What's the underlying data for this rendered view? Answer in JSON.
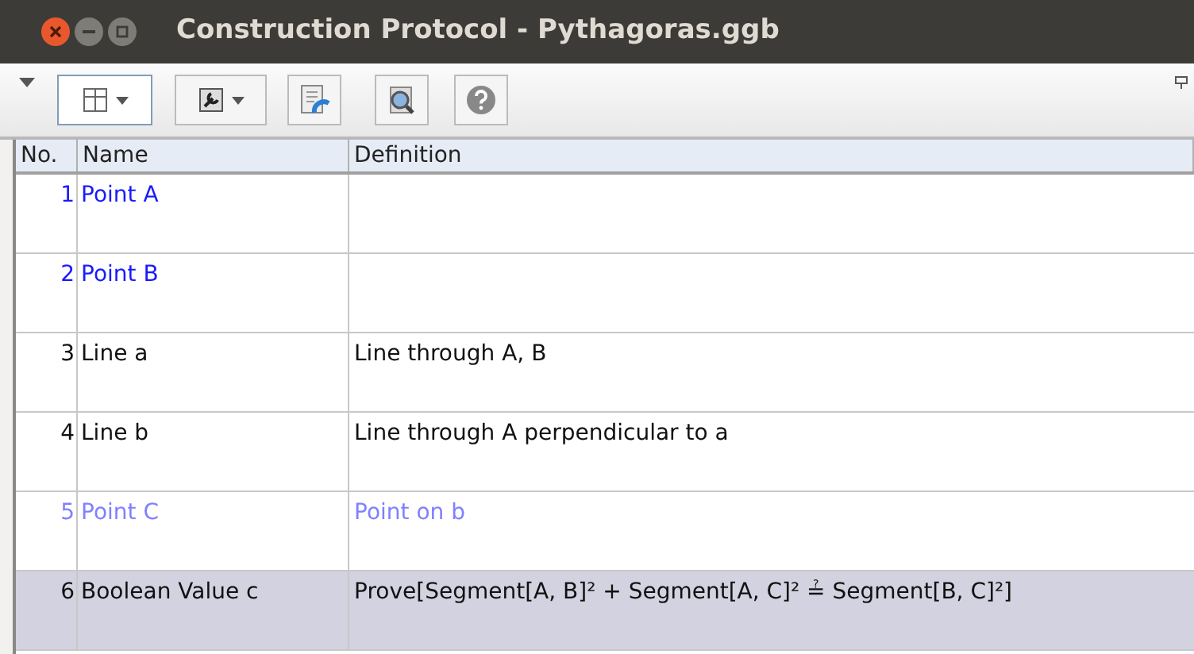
{
  "window": {
    "title": "Construction Protocol - Pythagoras.ggb"
  },
  "table": {
    "columns": [
      "No.",
      "Name",
      "Definition"
    ],
    "rows": [
      {
        "number": "1",
        "name": "Point A",
        "definition": "",
        "color": "#1a1aff",
        "selected": false
      },
      {
        "number": "2",
        "name": "Point B",
        "definition": "",
        "color": "#1a1aff",
        "selected": false
      },
      {
        "number": "3",
        "name": "Line a",
        "definition": "Line through A, B",
        "color": "#111111",
        "selected": false
      },
      {
        "number": "4",
        "name": "Line b",
        "definition": "Line through A perpendicular to a",
        "color": "#111111",
        "selected": false
      },
      {
        "number": "5",
        "name": "Point C",
        "definition": "Point on b",
        "color": "#8080ff",
        "selected": false
      },
      {
        "number": "6",
        "name": "Boolean Value c",
        "definition": "Prove[Segment[A, B]² + Segment[A, C]² ≟ Segment[B, C]²]",
        "color": "#111111",
        "selected": true
      }
    ]
  }
}
